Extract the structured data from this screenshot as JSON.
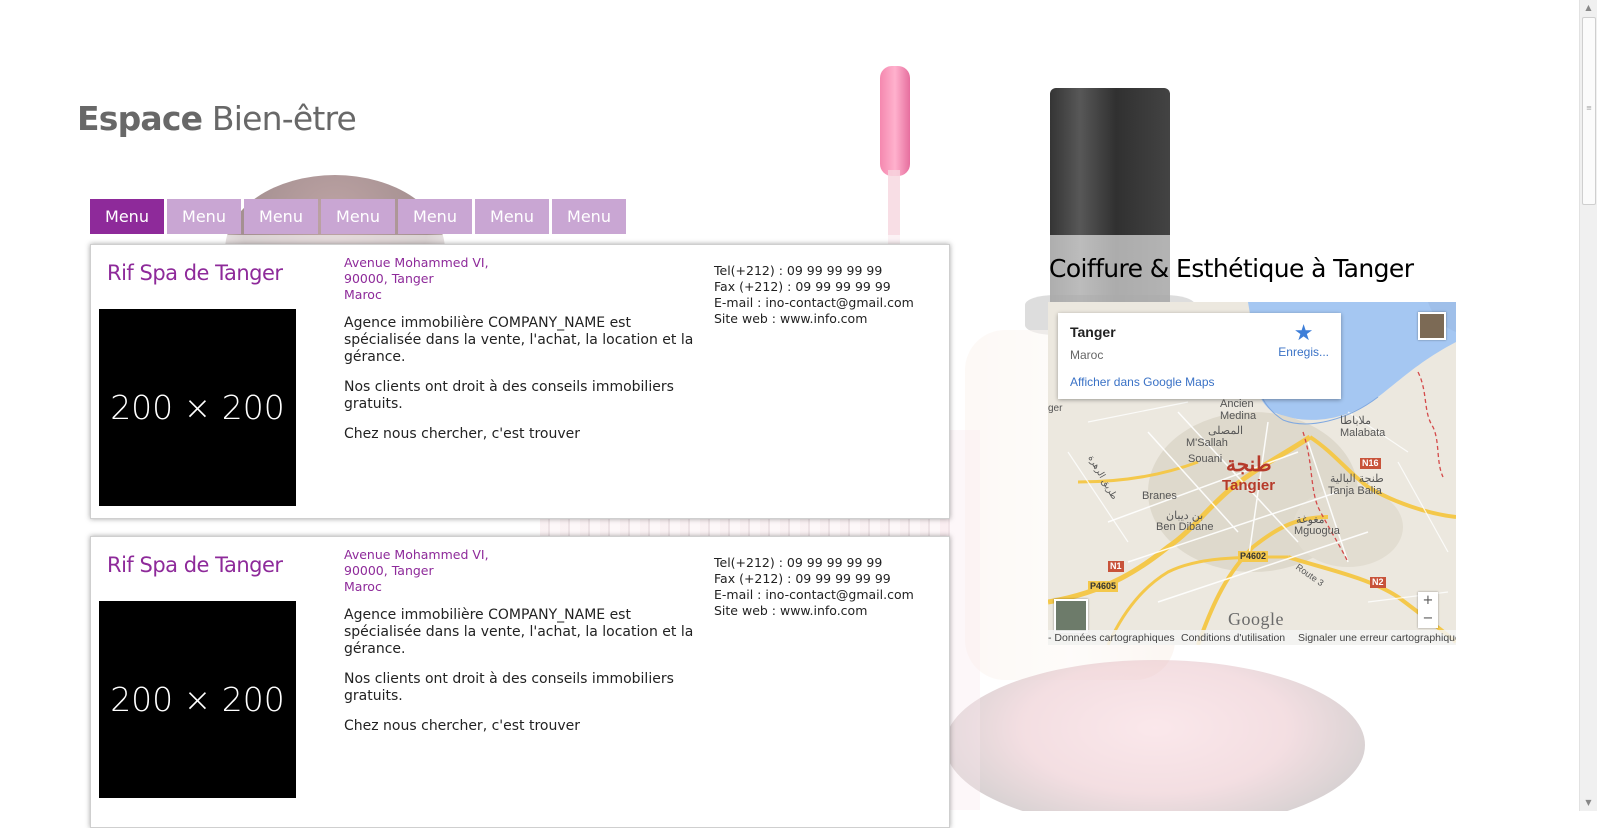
{
  "site": {
    "title_bold": "Espace",
    "title_light": "Bien-être"
  },
  "nav": {
    "items": [
      "Menu",
      "Menu",
      "Menu",
      "Menu",
      "Menu",
      "Menu",
      "Menu"
    ],
    "active_index": 0
  },
  "listings": [
    {
      "name": "Rif Spa de Tanger",
      "thumb_text": "200 × 200",
      "address": [
        "Avenue Mohammed VI,",
        "90000, Tanger",
        "Maroc"
      ],
      "description": [
        "Agence immobilière COMPANY_NAME est spécialisée dans la vente, l'achat, la location et la gérance.",
        "Nos clients ont droit à des conseils immobiliers gratuits.",
        "Chez nous chercher, c'est trouver"
      ],
      "contact": [
        "Tel(+212) : 09 99 99 99 99",
        "Fax (+212) : 09 99 99 99 99",
        "E-mail : ino-contact@gmail.com",
        "Site web : www.info.com"
      ]
    },
    {
      "name": "Rif Spa de Tanger",
      "thumb_text": "200 × 200",
      "address": [
        "Avenue Mohammed VI,",
        "90000, Tanger",
        "Maroc"
      ],
      "description": [
        "Agence immobilière COMPANY_NAME est spécialisée dans la vente, l'achat, la location et la gérance.",
        "Nos clients ont droit à des conseils immobiliers gratuits.",
        "Chez nous chercher, c'est trouver"
      ],
      "contact": [
        "Tel(+212) : 09 99 99 99 99",
        "Fax (+212) : 09 99 99 99 99",
        "E-mail : ino-contact@gmail.com",
        "Site web : www.info.com"
      ]
    }
  ],
  "aside": {
    "title": "Coiffure & Esthétique à Tanger"
  },
  "map": {
    "place": "Tanger",
    "country": "Maroc",
    "save_label": "Enregis...",
    "open_link": "Afficher dans Google Maps",
    "logo": "Google",
    "zoom_in": "+",
    "zoom_out": "−",
    "footer": [
      "- Données cartographiques",
      "Conditions d'utilisation",
      "Signaler une erreur cartographique"
    ],
    "labels": {
      "city_ar": "طنجة",
      "city": "Tangier",
      "malabata_ar": "ملاباطا",
      "malabata": "Malabata",
      "ancien_medina": "Ancien",
      "medina": "Medina",
      "msallah_ar": "المصلى",
      "msallah": "M'Sallah",
      "souani": "Souani",
      "branes": "Branes",
      "bendibane_ar": "بن ديبان",
      "bendibane": "Ben Dibane",
      "tanjabalia_ar": "طنجة البالية",
      "tanjabalia": "Tanja Balia",
      "mguogua_ar": "مغوغة",
      "mguogua": "Mguogua",
      "route_ar": "طريق الرهرة",
      "route3": "Route 3",
      "ger": "ger"
    },
    "roads": [
      "N16",
      "N1",
      "P4605",
      "P4602",
      "N2"
    ],
    "colors": {
      "water": "#a5c7f2",
      "land": "#ece8df",
      "highway": "#f4c84b",
      "road": "#ffffff"
    }
  },
  "colors": {
    "accent": "#8e2a9a",
    "nav_inactive": "#c9a6d3",
    "title": "#686868"
  }
}
